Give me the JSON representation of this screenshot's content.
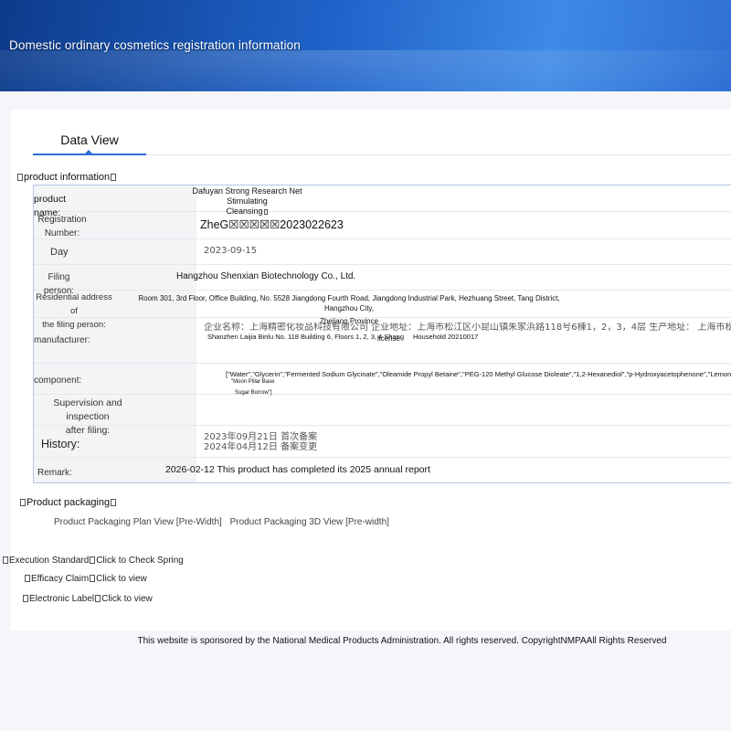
{
  "banner": {
    "title": "Domestic ordinary cosmetics registration information"
  },
  "tabs": {
    "data_view": "Data View"
  },
  "sections": {
    "product_info": "product information",
    "product_packaging": "Product packaging"
  },
  "fields": {
    "product_name": {
      "label": "product name:",
      "value_line1": "Dafuyan Strong Research Net Stimulating",
      "value_line2": "Cleansing"
    },
    "registration": {
      "label_line1": "Registration",
      "label_line2": "Number:",
      "value": "ZheG☒☒☒☒☒2023022623"
    },
    "day": {
      "label": "Day",
      "value": "2023-09-15"
    },
    "filing_person": {
      "label": "Filing person:",
      "value": "Hangzhou Shenxian Biotechnology Co., Ltd."
    },
    "address": {
      "label_line1": "Residential address of",
      "label_line2": "the filing person:",
      "value_line1": "Room 301, 3rd Floor, Office Building, No. 5528 Jiangdong Fourth Road, Jiangdong Industrial Park, Hezhuang Street, Tang District, Hangzhou City,",
      "value_line2": "Zhejiang Province"
    },
    "manufacturer": {
      "label": "manufacturer:",
      "value_cn": "企业名称：上海精密化妆品科技有限公司 企业地址：上海市松江区小昆山镇朱家浜路118号6棟1，2，3，4层 生产地址： 上海市松江区小",
      "value_en": "Shanzhen Laijia Binlu No. 118 Building 6, Floors 1, 2, 3, 4 Shang",
      "license": "license",
      "household": "Household 20210017"
    },
    "component": {
      "label": "component:",
      "value_line1": "[\"Water\",\"Glycerin\",\"Fermented Sodium Glycinate\",\"Oleamide Propyl Betaine\",\"PEG-120 Methyl Glucose Dioleate\",\"1,2-Hexanediol\",\"p-Hydroxyacetophenone\",\"Lemon",
      "value_line2": "\"Moon Pillar Base",
      "value_line3": "Sugar Borrow\"]"
    },
    "supervision": {
      "label_line1": "Supervision and inspection",
      "label_line2": "after filing:"
    },
    "history": {
      "label": "History:",
      "line1": "2023年09月21日 首次备案",
      "line2": "2024年04月12日 备案变更"
    },
    "remark": {
      "label": "Remark:",
      "value": "2026-02-12 This product has completed its 2025 annual report"
    }
  },
  "packaging": {
    "plan_view": "Product Packaging Plan View [Pre-Width]",
    "view_3d": "Product Packaging 3D View [Pre-width]"
  },
  "links": {
    "execution_standard": {
      "label": "Execution Standard",
      "action": "Click to Check Spring"
    },
    "efficacy_claim": {
      "label": "Efficacy Claim",
      "action": "Click to view"
    },
    "electronic_label": {
      "label": "Electronic Label",
      "action": "Click to view"
    }
  },
  "footer": {
    "text": "This website is sponsored by the National Medical Products Administration. All rights reserved. CopyrightNMPAAll Rights Reserved"
  },
  "colors": {
    "banner": "#1f63c9",
    "accent": "#2b6fd6",
    "table_border": "#b6c6e2"
  }
}
